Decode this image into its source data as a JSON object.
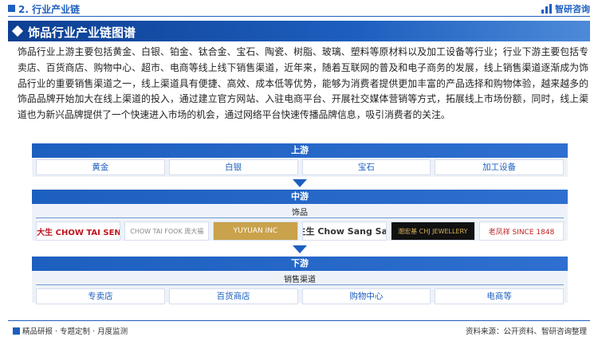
{
  "header": {
    "section_title": "2. 行业产业链",
    "logo_text": "智研咨询"
  },
  "banner": {
    "title": "饰品行业产业链图谱"
  },
  "description": "饰品行业上游主要包括黄金、白银、铂金、钛合金、宝石、陶瓷、树脂、玻璃、塑料等原材料以及加工设备等行业；行业下游主要包括专卖店、百货商店、购物中心、超市、电商等线上线下销售渠道，近年来，随着互联网的普及和电子商务的发展，线上销售渠道逐渐成为饰品行业的重要销售渠道之一，线上渠道具有便捷、高效、成本低等优势，能够为消费者提供更加丰富的产品选择和购物体验，越来越多的饰品品牌开始加大在线上渠道的投入，通过建立官方网站、入驻电商平台、开展社交媒体营销等方式，拓展线上市场份额，同时，线上渠道也为新兴品牌提供了一个快速进入市场的机会，通过网络平台快速传播品牌信息，吸引消费者的关注。",
  "upstream": {
    "title": "上游",
    "items": [
      "黄金",
      "白银",
      "宝石",
      "加工设备"
    ]
  },
  "midstream": {
    "title": "中游",
    "sublabel": "饰品",
    "brands": [
      {
        "text": "周大生 CHOW TAI SENG"
      },
      {
        "text": "CHOW TAI FOOK 周大福"
      },
      {
        "text": "YUYUAN INC"
      },
      {
        "text": "周生生 Chow Sang Sang"
      },
      {
        "text": "潮宏基 CHJ JEWELLERY"
      },
      {
        "text": "老凤祥 SINCE 1848"
      }
    ]
  },
  "downstream": {
    "title": "下游",
    "sublabel": "销售渠道",
    "items": [
      "专卖店",
      "百货商店",
      "购物中心",
      "电商等"
    ]
  },
  "footer": {
    "left": "精品研报 · 专题定制 · 月度监测",
    "right": "资料来源：公开资料、智研咨询整理"
  },
  "colors": {
    "primary": "#1d5fbf",
    "panel": "#eef2f8"
  }
}
